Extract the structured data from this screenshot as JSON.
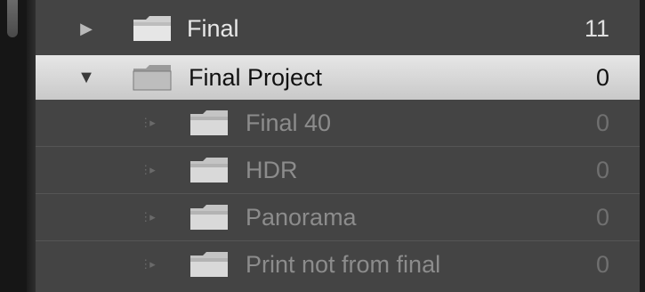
{
  "folders": [
    {
      "name": "Final",
      "count": "11",
      "icon": "folder-icon",
      "arrow": "disclosure-collapsed-icon"
    },
    {
      "name": "Final Project",
      "count": "0",
      "icon": "folder-icon",
      "arrow": "disclosure-expanded-icon",
      "selected": true
    },
    {
      "name": "Final 40",
      "count": "0",
      "icon": "folder-icon",
      "arrow": "disclosure-empty-icon"
    },
    {
      "name": "HDR",
      "count": "0",
      "icon": "folder-icon",
      "arrow": "disclosure-empty-icon"
    },
    {
      "name": "Panorama",
      "count": "0",
      "icon": "folder-icon",
      "arrow": "disclosure-empty-icon"
    },
    {
      "name": "Print not from final",
      "count": "0",
      "icon": "folder-icon",
      "arrow": "disclosure-empty-icon"
    }
  ],
  "colors": {
    "panel_bg": "#444444",
    "selected_bg": "#d8d8d8",
    "text_primary": "#e8e8e8",
    "text_dim": "#8c8c8c"
  }
}
